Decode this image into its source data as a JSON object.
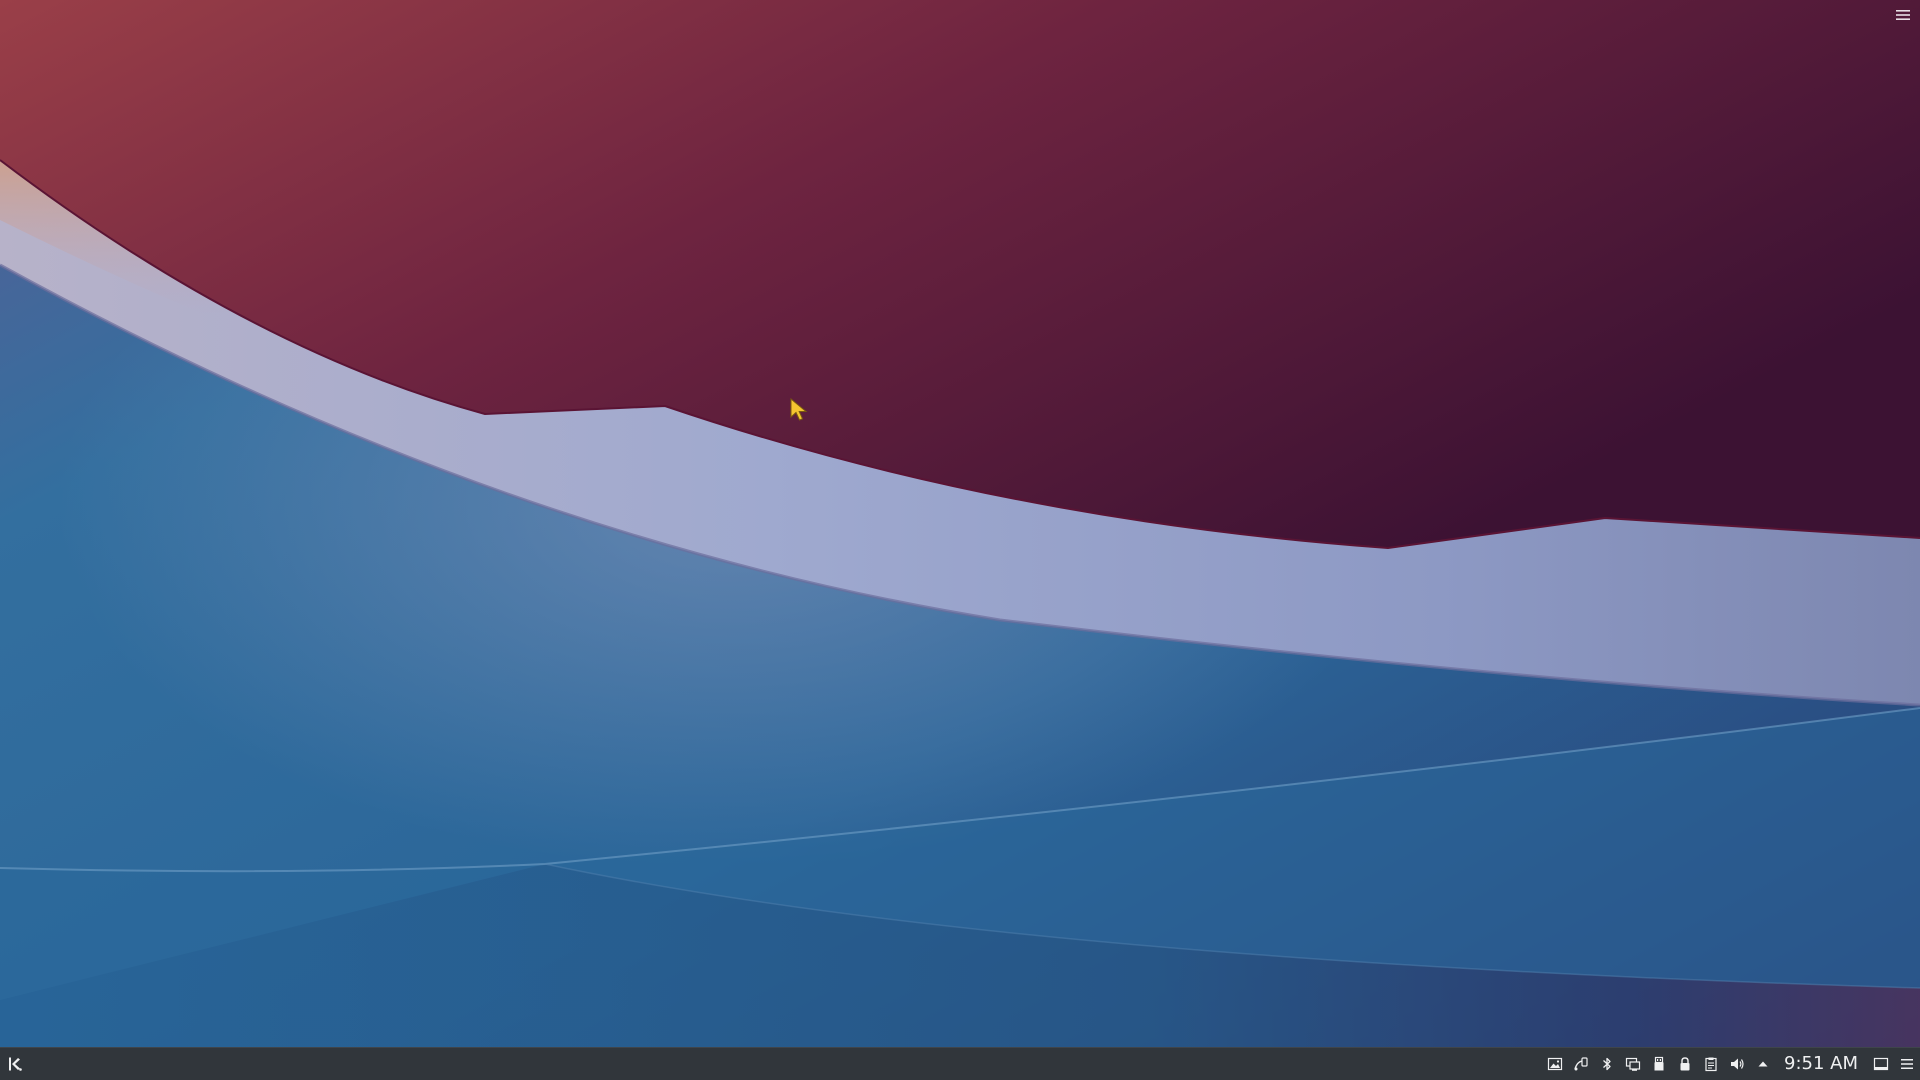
{
  "panel": {
    "clock": {
      "time": "9:51 AM"
    },
    "launcher_icon": "kde-application-launcher-icon",
    "tray_icons": [
      "image-viewer-icon",
      "kde-connect-icon",
      "bluetooth-icon",
      "display-configuration-icon",
      "usb-device-icon",
      "lock-icon",
      "clipboard-icon",
      "volume-icon",
      "expand-tray-arrow-icon"
    ],
    "show_desktop_icon": "show-desktop-icon",
    "panel_menu_icon": "panel-menu-icon"
  },
  "desktop": {
    "toolbox_icon": "desktop-toolbox-hamburger-icon",
    "cursor_icon": "mouse-pointer-icon"
  },
  "colors": {
    "panel_bg": "#31363b",
    "panel_fg": "#eff0f1",
    "wall_top_left": "#9a3f48",
    "wall_top_right": "#3c1233",
    "wall_band": "#9aa6cc",
    "wall_blue": "#2a6a9c",
    "cursor": "#f4c430"
  }
}
